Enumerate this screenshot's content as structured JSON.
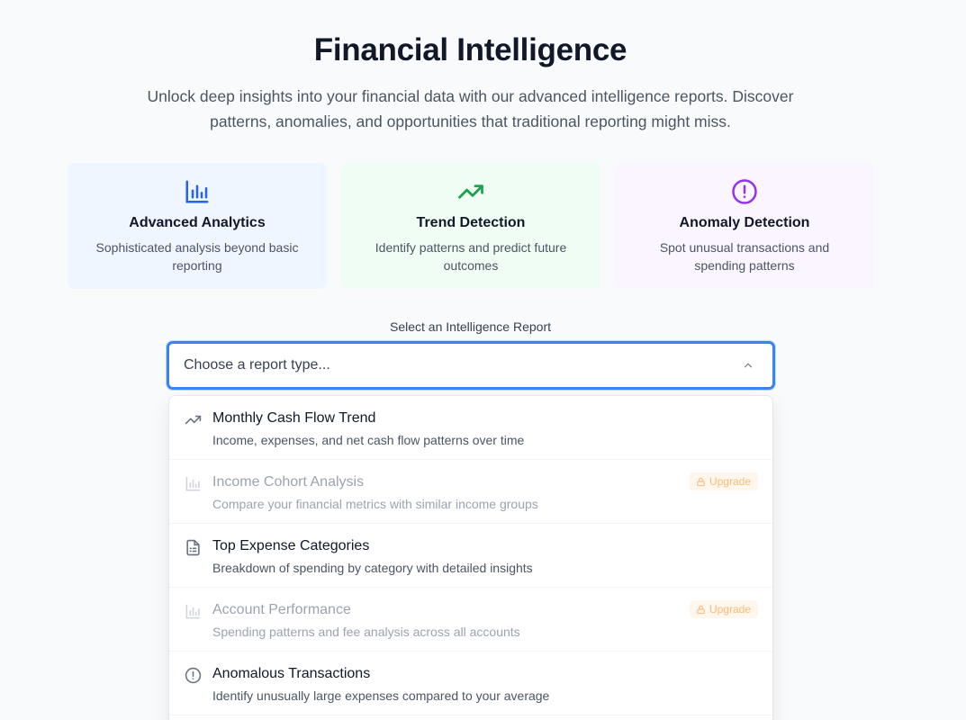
{
  "header": {
    "title": "Financial Intelligence",
    "intro": "Unlock deep insights into your financial data with our advanced intelligence reports. Discover patterns, anomalies, and opportunities that traditional reporting might miss."
  },
  "features": [
    {
      "title": "Advanced Analytics",
      "desc": "Sophisticated analysis beyond basic reporting",
      "icon": "bar-chart-icon",
      "color": "#2563eb"
    },
    {
      "title": "Trend Detection",
      "desc": "Identify patterns and predict future outcomes",
      "icon": "trending-up-icon",
      "color": "#16a34a"
    },
    {
      "title": "Anomaly Detection",
      "desc": "Spot unusual transactions and spending patterns",
      "icon": "alert-circle-icon",
      "color": "#9333ea"
    }
  ],
  "report_select": {
    "label": "Select an Intelligence Report",
    "placeholder": "Choose a report type...",
    "options": [
      {
        "title": "Monthly Cash Flow Trend",
        "desc": "Income, expenses, and net cash flow patterns over time",
        "icon": "trending-up-icon",
        "locked": false
      },
      {
        "title": "Income Cohort Analysis",
        "desc": "Compare your financial metrics with similar income groups",
        "icon": "bar-chart-icon",
        "locked": true,
        "badge": "Upgrade"
      },
      {
        "title": "Top Expense Categories",
        "desc": "Breakdown of spending by category with detailed insights",
        "icon": "document-list-icon",
        "locked": false
      },
      {
        "title": "Account Performance",
        "desc": "Spending patterns and fee analysis across all accounts",
        "icon": "bar-chart-icon",
        "locked": true,
        "badge": "Upgrade"
      },
      {
        "title": "Anomalous Transactions",
        "desc": "Identify unusually large expenses compared to your average",
        "icon": "alert-circle-icon",
        "locked": false
      }
    ]
  }
}
